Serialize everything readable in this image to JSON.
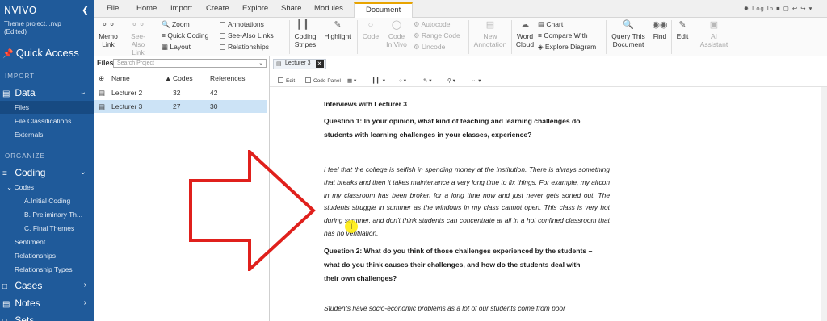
{
  "app": {
    "logo": "NVIVO",
    "project_name": "Theme project...nvp",
    "project_status": "(Edited)",
    "login": "Log In"
  },
  "sidebar": {
    "quick_access": "Quick Access",
    "import_label": "IMPORT",
    "data": {
      "label": "Data",
      "items": [
        "Files",
        "File Classifications",
        "Externals"
      ],
      "selected": "Files"
    },
    "organize_label": "ORGANIZE",
    "coding": {
      "label": "Coding",
      "codes_label": "Codes",
      "codes": [
        "A.Initial Coding",
        "B. Preliminary Th...",
        "C. Final Themes"
      ],
      "items": [
        "Sentiment",
        "Relationships",
        "Relationship Types"
      ]
    },
    "cases_label": "Cases",
    "notes_label": "Notes",
    "sets_label": "Sets"
  },
  "ribbon": {
    "tabs": [
      "File",
      "Home",
      "Import",
      "Create",
      "Explore",
      "Share",
      "Modules",
      "Document"
    ],
    "active_tab": "Document",
    "memo_link": [
      "Memo",
      "Link"
    ],
    "see_also_link": [
      "See-Also",
      "Link"
    ],
    "zoom": "Zoom",
    "quick_coding": "Quick Coding",
    "layout": "Layout",
    "annotations": "Annotations",
    "see_also_links": "See-Also Links",
    "relationships": "Relationships",
    "coding_stripes": [
      "Coding",
      "Stripes"
    ],
    "highlight": "Highlight",
    "code": "Code",
    "code_in_vivo": [
      "Code",
      "In Vivo"
    ],
    "autocode": "Autocode",
    "range_code": "Range Code",
    "uncode": "Uncode",
    "new_annotation": [
      "New",
      "Annotation"
    ],
    "word_cloud": [
      "Word",
      "Cloud"
    ],
    "chart": "Chart",
    "compare_with": "Compare With",
    "explore_diagram": "Explore Diagram",
    "query_this_document": [
      "Query This",
      "Document"
    ],
    "find": "Find",
    "edit": "Edit",
    "ai_assistant": [
      "AI",
      "Assistant"
    ]
  },
  "files_pane": {
    "title": "Files",
    "search_placeholder": "Search Project",
    "columns": [
      "Name",
      "Codes",
      "References"
    ],
    "rows": [
      {
        "name": "Lecturer 2",
        "codes": "32",
        "references": "42"
      },
      {
        "name": "Lecturer 3",
        "codes": "27",
        "references": "30"
      }
    ],
    "selected_row": "Lecturer 3"
  },
  "document": {
    "tab_title": "Lecturer 3",
    "toolbar": {
      "edit": "Edit",
      "code_panel": "Code Panel"
    },
    "heading": "Interviews with Lecturer 3",
    "question1": [
      "Question 1: In your opinion, what kind of teaching and learning challenges do",
      "students with learning challenges in your classes, experience?"
    ],
    "answer1": "I feel that the college is selfish in spending money at the institution. There is always something that breaks and then it takes maintenance a very long time to fix things. For example, my aircon in my classroom has been broken for a long time now and just never gets sorted out. The students struggle in summer as the windows in my class cannot open. This class is very hot during summer, and don't think students can concentrate at all in a hot confined classroom that has no ventilation.",
    "question2": [
      "Question 2:  What do you think of those challenges experienced by the students –",
      "what do you think causes their challenges, and how do the students deal with",
      "their own challenges?"
    ],
    "answer2_start": "Students have socio-economic problems as a lot of our students come from poor"
  },
  "colors": {
    "sidebar_bg": "#1f5a9a",
    "selected_row": "#cce3f6",
    "active_tab_accent": "#e8a400",
    "annotation_arrow": "#e0201c",
    "cursor_highlight": "#ffeb00"
  }
}
